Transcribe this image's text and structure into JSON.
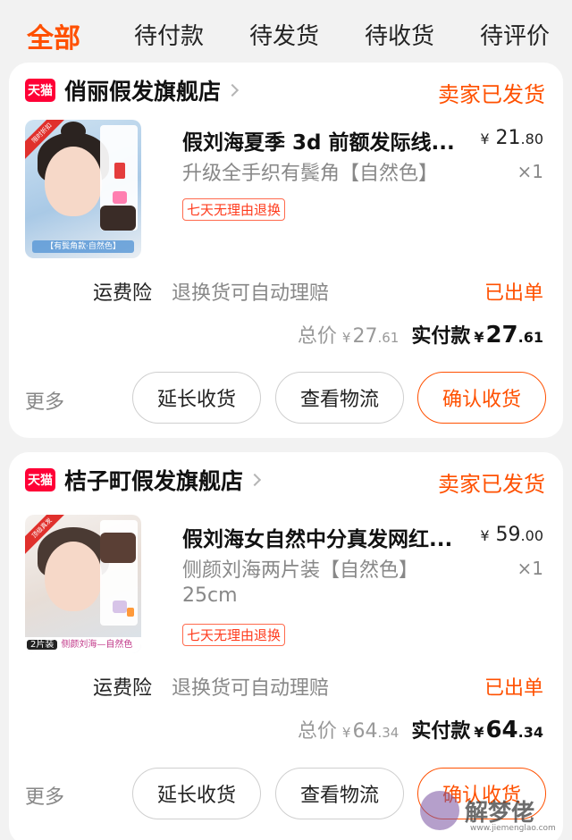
{
  "tabs": [
    "全部",
    "待付款",
    "待发货",
    "待收货",
    "待评价"
  ],
  "orders": [
    {
      "badge": "天猫",
      "store_name": "俏丽假发旗舰店",
      "status": "卖家已发货",
      "thumb_strip_text": "【有鬓角款·自然色】",
      "thumb_corner_text": "限时折扣",
      "title": "假刘海夏季 3d 前额发际线...",
      "price_int": "21",
      "price_dec": ".80",
      "variant": "升级全手织有鬓角【自然色】",
      "variant_line2": "",
      "quantity": "×1",
      "tag": "七天无理由退换",
      "insurance_label": "运费险",
      "insurance_desc": "退换货可自动理赔",
      "insurance_status": "已出单",
      "total_label": "总价",
      "total_int": "27",
      "total_dec": ".61",
      "paid_label": "实付款",
      "paid_int": "27",
      "paid_dec": ".61",
      "more": "更多",
      "btn_extend": "延长收货",
      "btn_logistics": "查看物流",
      "btn_confirm": "确认收货"
    },
    {
      "badge": "天猫",
      "store_name": "桔子町假发旗舰店",
      "status": "卖家已发货",
      "thumb_pill": "2片装",
      "thumb_strip_text": "侧颜刘海—自然色",
      "thumb_corner_text": "顶级真发",
      "title": "假刘海女自然中分真发网红...",
      "price_int": "59",
      "price_dec": ".00",
      "variant": "侧颜刘海两片装【自然色】",
      "variant_line2": "25cm",
      "quantity": "×1",
      "tag": "七天无理由退换",
      "insurance_label": "运费险",
      "insurance_desc": "退换货可自动理赔",
      "insurance_status": "已出单",
      "total_label": "总价",
      "total_int": "64",
      "total_dec": ".34",
      "paid_label": "实付款",
      "paid_int": "64",
      "paid_dec": ".34",
      "more": "更多",
      "btn_extend": "延长收货",
      "btn_logistics": "查看物流",
      "btn_confirm": "确认收货"
    }
  ],
  "currency": "¥",
  "watermark": {
    "text": "解梦佬",
    "url": "www.jiemenglao.com"
  },
  "colors": {
    "accent": "#ff5000",
    "tmall": "#ff0036",
    "background": "#f2f2f2"
  }
}
